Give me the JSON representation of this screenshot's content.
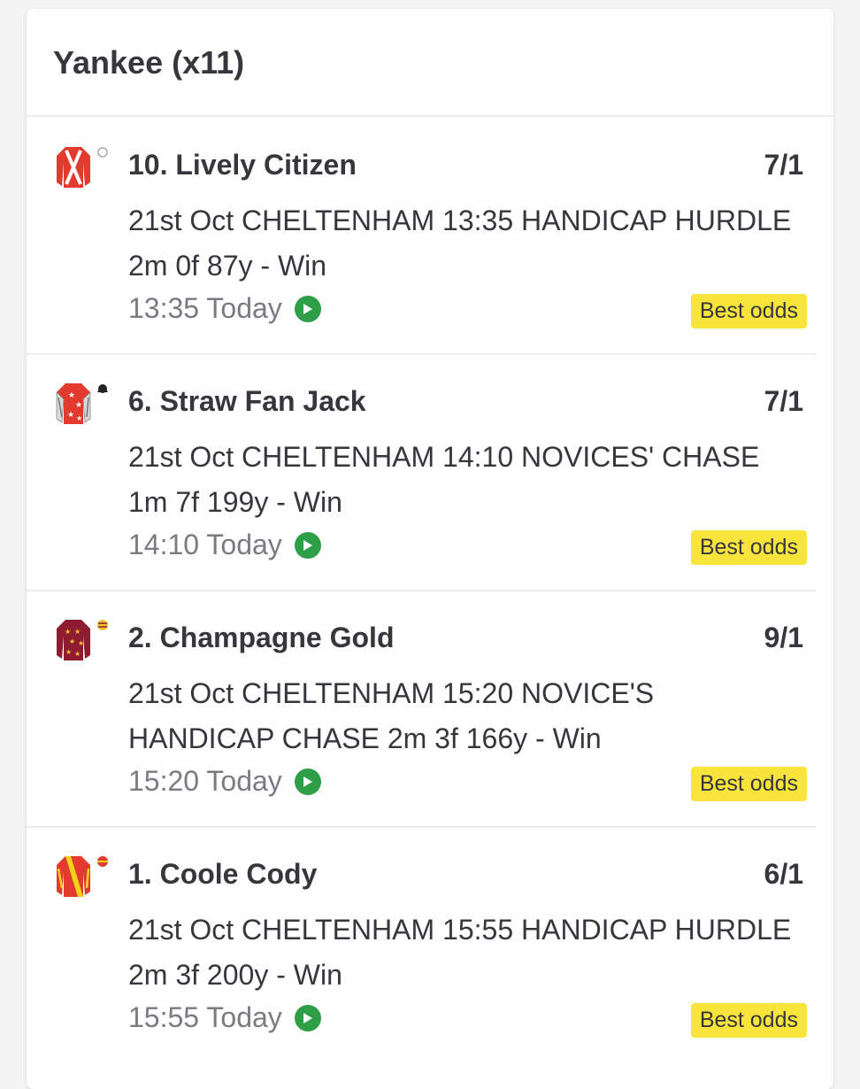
{
  "bet": {
    "title": "Yankee (x11)"
  },
  "badge_color": "#f9e43c",
  "play_icon_color": "#2e9e47",
  "selections": [
    {
      "name": "10. Lively Citizen",
      "odds": "7/1",
      "description": "21st Oct CHELTENHAM 13:35 HANDICAP HURDLE 2m 0f 87y - Win",
      "time": "13:35 Today",
      "badge": "Best odds",
      "silks_icon": "red-white-cross-silks-icon"
    },
    {
      "name": "6. Straw Fan Jack",
      "odds": "7/1",
      "description": "21st Oct CHELTENHAM 14:10 NOVICES' CHASE 1m 7f 199y - Win",
      "time": "14:10 Today",
      "badge": "Best odds",
      "silks_icon": "red-white-stars-silks-icon"
    },
    {
      "name": "2. Champagne Gold",
      "odds": "9/1",
      "description": "21st Oct CHELTENHAM 15:20 NOVICE'S HANDICAP CHASE 2m 3f 166y - Win",
      "time": "15:20 Today",
      "badge": "Best odds",
      "silks_icon": "maroon-gold-stars-silks-icon"
    },
    {
      "name": "1. Coole Cody",
      "odds": "6/1",
      "description": "21st Oct CHELTENHAM 15:55 HANDICAP HURDLE 2m 3f 200y - Win",
      "time": "15:55 Today",
      "badge": "Best odds",
      "silks_icon": "red-yellow-sash-silks-icon"
    }
  ]
}
